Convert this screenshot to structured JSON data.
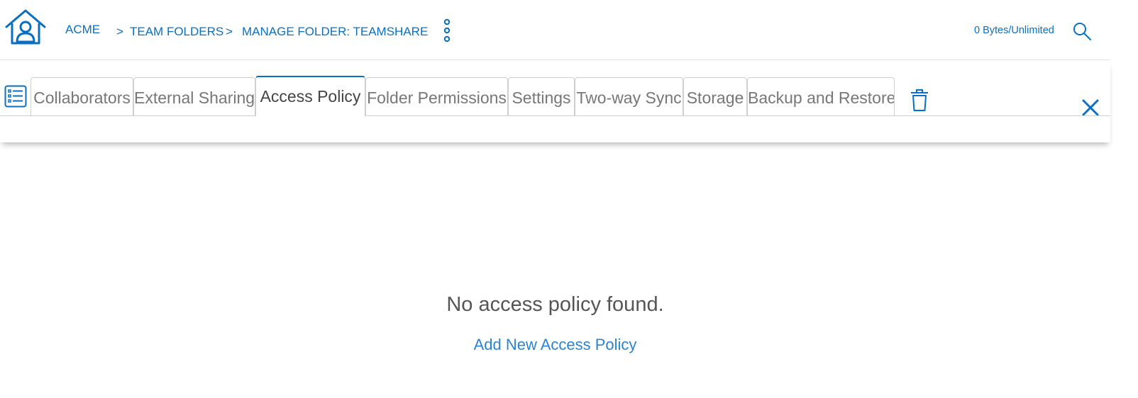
{
  "header": {
    "breadcrumb": {
      "root": "ACME",
      "separator": ">",
      "items": [
        "TEAM FOLDERS",
        "MANAGE FOLDER: TEAMSHARE"
      ]
    },
    "quota": "0 Bytes/Unlimited"
  },
  "tabs": [
    {
      "label": "Collaborators",
      "active": false
    },
    {
      "label": "External Sharing",
      "active": false
    },
    {
      "label": "Access Policy",
      "active": true
    },
    {
      "label": "Folder Permissions",
      "active": false
    },
    {
      "label": "Settings",
      "active": false
    },
    {
      "label": "Two-way Sync",
      "active": false
    },
    {
      "label": "Storage",
      "active": false
    },
    {
      "label": "Backup and Restore",
      "active": false
    }
  ],
  "content": {
    "empty_message": "No access policy found.",
    "add_link": "Add New Access Policy"
  },
  "icons": {
    "home": "home-icon",
    "more": "more-vertical-icon",
    "search": "search-icon",
    "list": "list-icon",
    "trash": "trash-icon",
    "close": "close-icon"
  },
  "colors": {
    "accent": "#0a6fc2",
    "link": "#2a84d2",
    "tab_border": "#cfcfcf"
  }
}
